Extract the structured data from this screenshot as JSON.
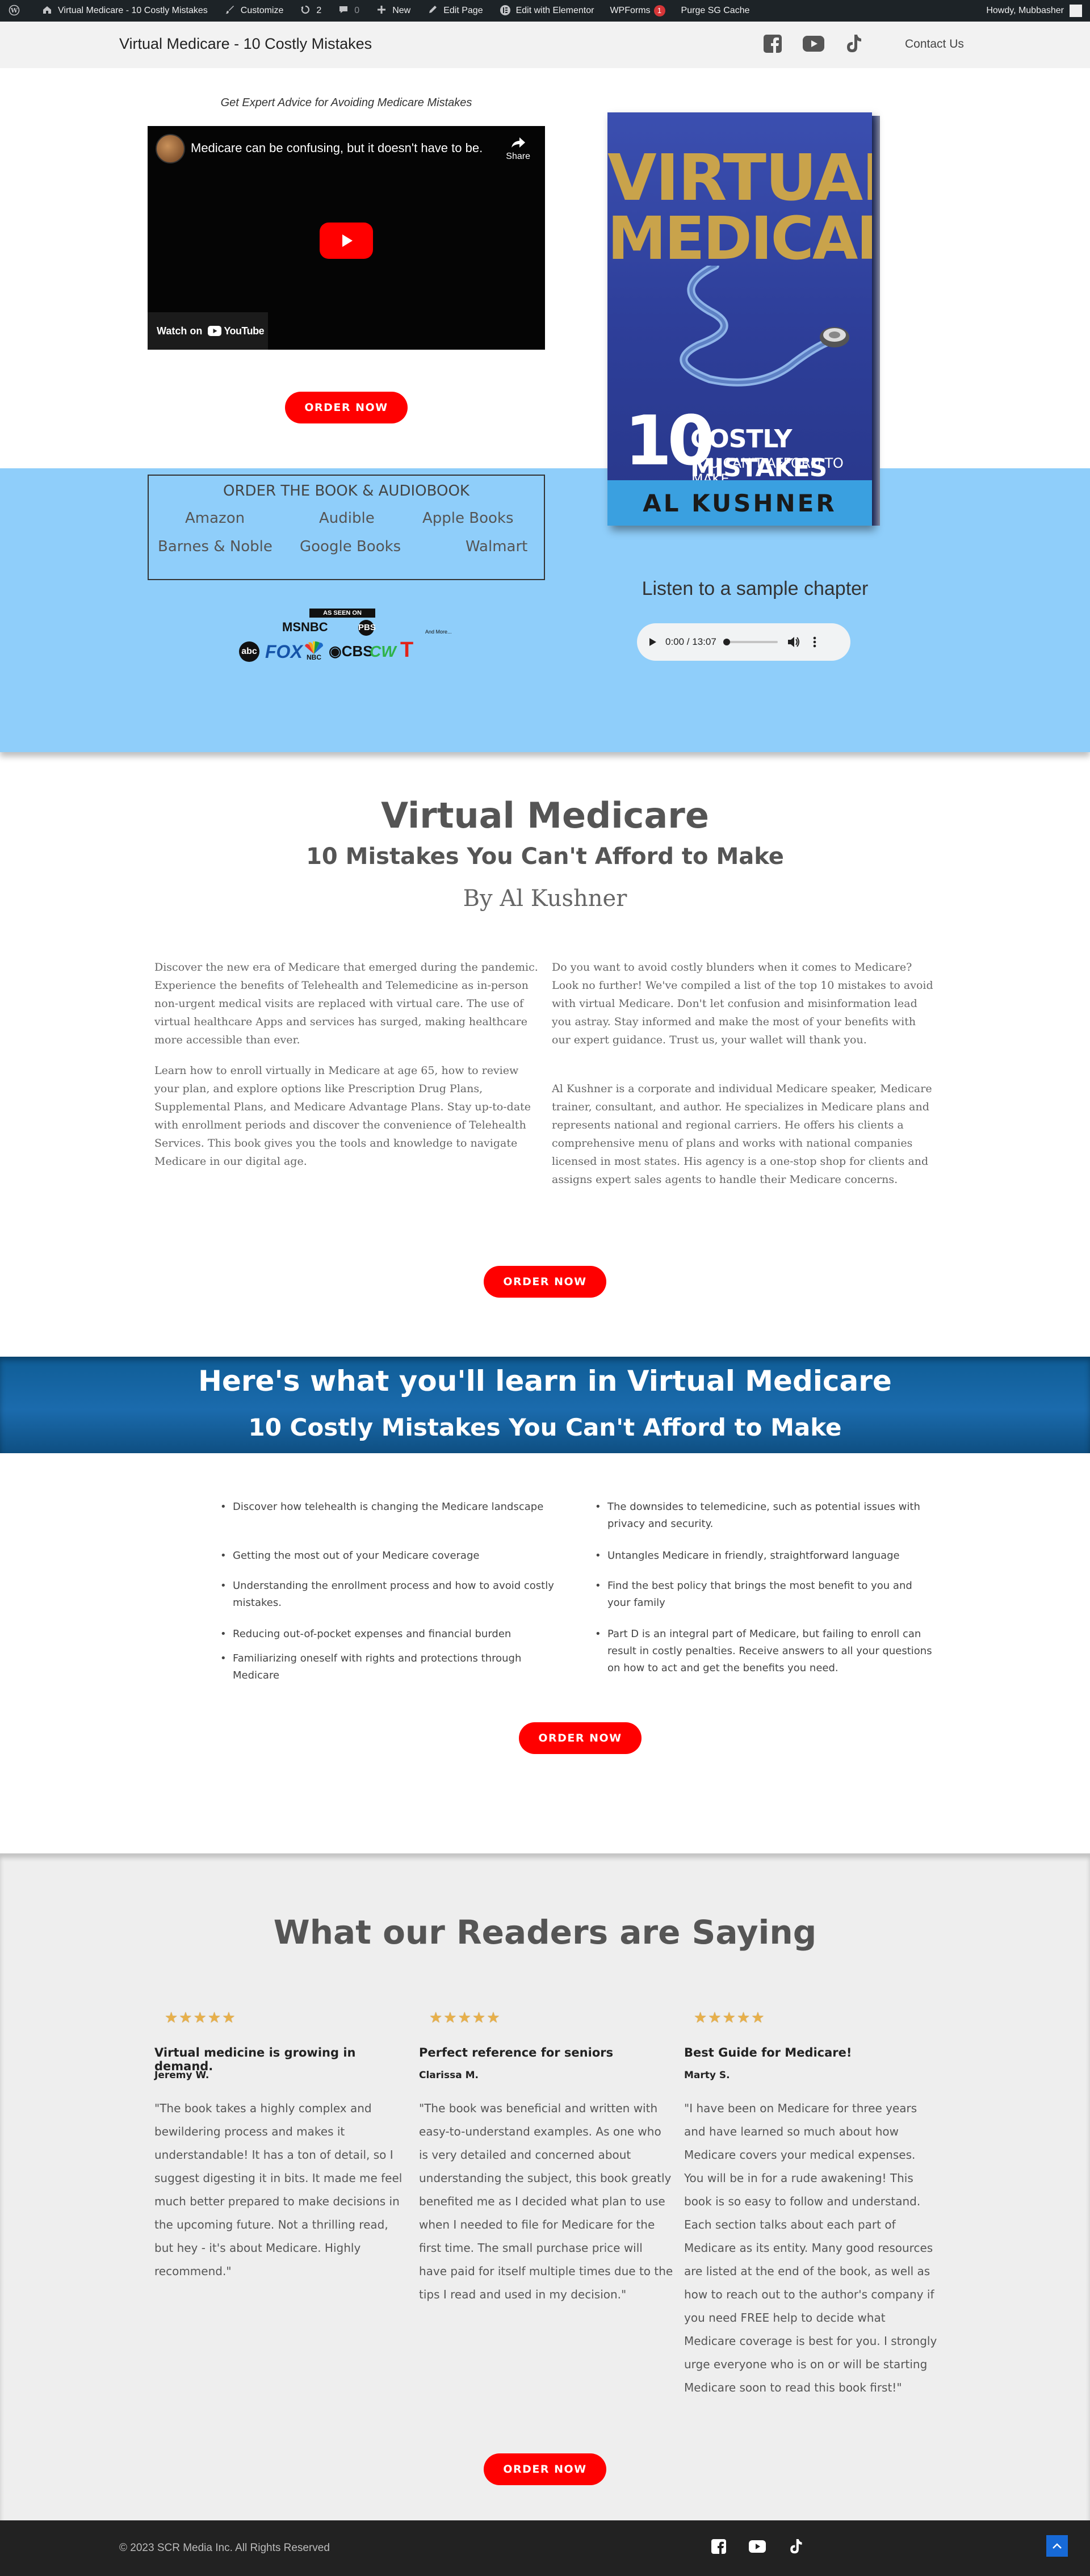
{
  "admin_bar": {
    "site_name": "Virtual Medicare - 10 Costly Mistakes",
    "customize": "Customize",
    "updates_count": "2",
    "comments_count": "0",
    "new": "New",
    "edit_page": "Edit Page",
    "edit_elementor": "Edit with Elementor",
    "wpforms": "WPForms",
    "wpforms_badge": "1",
    "purge_cache": "Purge SG Cache",
    "howdy": "Howdy, Mubbasher"
  },
  "header": {
    "site_title": "Virtual Medicare - 10 Costly Mistakes",
    "icons": [
      "facebook-icon",
      "youtube-icon",
      "tiktok-icon"
    ],
    "contact_link": "Contact Us"
  },
  "hero": {
    "video_caption": "Get Expert Advice for Avoiding Medicare Mistakes",
    "video_title": "Medicare can be confusing, but it doesn't have to be.",
    "video_share": "Share",
    "video_watch_on": "Watch on",
    "video_youtube": "YouTube",
    "order_button": "ORDER NOW",
    "book": {
      "title_line1": "VIRTUAL",
      "title_line2": "MEDICARE",
      "number": "10",
      "subtitle_line1": "COSTLY MISTAKES",
      "subtitle_line2": "YOU CAN'T AFFORD TO MAKE",
      "author": "AL KUSHNER"
    },
    "order_box": {
      "title": "ORDER THE BOOK & AUDIOBOOK",
      "links": [
        "Amazon",
        "Audible",
        "Apple Books",
        "Barnes & Noble",
        "Google Books",
        "Walmart"
      ]
    },
    "as_seen_on": {
      "tag": "AS SEEN ON",
      "logos": [
        "MSNBC",
        "PBS",
        "And More...",
        "abc",
        "FOX",
        "NBC",
        "CBS",
        "CW",
        "T"
      ]
    },
    "sample_title": "Listen to a sample chapter",
    "audio_time": "0:00 / 13:07"
  },
  "about": {
    "title": "Virtual Medicare",
    "subtitle": "10 Mistakes You Can't Afford to Make",
    "author_line": "By Al Kushner",
    "left_p1": "Discover the new era of Medicare that emerged during the pandemic. Experience the benefits of Telehealth and Telemedicine as in-person non-urgent medical visits are replaced with virtual care. The use of virtual healthcare Apps and services has surged, making healthcare more accessible than ever.",
    "left_p2": "Learn how to enroll virtually in Medicare at age 65, how to review your plan, and explore options like Prescription Drug Plans, Supplemental Plans, and Medicare Advantage Plans. Stay up-to-date with enrollment periods and discover the convenience of Telehealth Services. This book gives you the tools and knowledge to navigate Medicare in our digital age.",
    "right_p1": "Do you want to avoid costly blunders when it comes to Medicare? Look no further! We've compiled a list of the top 10 mistakes to avoid with virtual Medicare. Don't let confusion and misinformation lead you astray. Stay informed and make the most of your benefits with our expert guidance. Trust us, your wallet will thank you.",
    "right_p2": "Al Kushner is a corporate and individual Medicare speaker, Medicare trainer, consultant, and author. He specializes in Medicare plans and represents national and regional carriers. He offers his clients a comprehensive menu of plans and works with national companies licensed in most states. His agency is a one-stop shop for clients and assigns expert sales agents to handle their Medicare concerns.",
    "order_button": "ORDER NOW"
  },
  "learn": {
    "title": "Here's what you'll learn in Virtual Medicare",
    "subtitle": "10 Costly Mistakes You Can't Afford to Make",
    "left_items": [
      "Discover how telehealth is changing the Medicare landscape",
      "Getting the most out of your Medicare coverage",
      "Understanding the enrollment process and how to avoid costly mistakes.",
      "Reducing out-of-pocket expenses and financial burden",
      "Familiarizing oneself with rights and protections through Medicare"
    ],
    "right_items": [
      "The downsides to telemedicine, such as potential issues with privacy and security.",
      "Untangles Medicare in friendly, straightforward language",
      "Find the best policy that brings the most benefit to you and your family",
      "Part D is an integral part of Medicare, but failing to enroll can result in costly penalties. Receive answers to all your questions on how to act and get the benefits you need."
    ],
    "order_button": "ORDER NOW"
  },
  "testimonials": {
    "title": "What our Readers are Saying",
    "stars": "★★★★★",
    "items": [
      {
        "headline": "Virtual medicine is growing in demand.",
        "name": "Jeremy W.",
        "body": "\"The book takes a highly complex and bewildering process and makes it understandable! It has a ton of detail, so I suggest digesting it in bits. It made me feel much better prepared to make decisions in the upcoming future. Not a thrilling read, but hey - it's about Medicare. Highly recommend.\""
      },
      {
        "headline": "Perfect reference for seniors",
        "name": "Clarissa M.",
        "body": "\"The book was beneficial and written with easy-to-understand examples. As one who is very detailed and concerned about understanding the subject, this book greatly benefited me as I decided what plan to use when I needed to file for Medicare for the first time. The small purchase price will have paid for itself multiple times due to the tips I read and used in my decision.\""
      },
      {
        "headline": "Best Guide for Medicare!",
        "name": "Marty S.",
        "body": "\"I have been on Medicare for three years and have learned so much about how Medicare covers your medical expenses. You will be in for a rude awakening! This book is so easy to follow and understand. Each section talks about each part of Medicare as its entity. Many good resources are listed at the end of the book, as well as how to reach out to the author's company if you need FREE help to decide what Medicare coverage is best for you. I strongly urge everyone who is on or will be starting Medicare soon to read this book first!\""
      }
    ],
    "order_button": "ORDER NOW"
  },
  "footer": {
    "copyright": "© 2023 SCR Media Inc. All Rights Reserved",
    "icons": [
      "facebook-icon",
      "youtube-icon",
      "tiktok-icon"
    ]
  },
  "colors": {
    "accent_red": "#ff0000",
    "hero_blue": "#8fcefa",
    "banner_blue": "#1b6bad",
    "admin_bar": "#1d2327",
    "footer": "#222222"
  }
}
